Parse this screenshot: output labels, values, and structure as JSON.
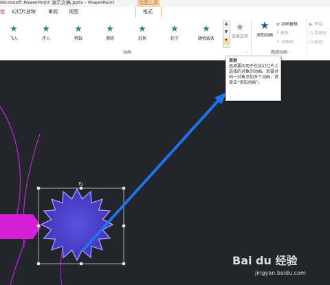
{
  "window": {
    "title": "演示文稿.pptx - PowerPoint",
    "title_prefix": "Microsoft PowerPoint"
  },
  "contextual_group": {
    "label": "绘图工具"
  },
  "tabs": [
    "幻灯片放映",
    "审阅",
    "视图",
    "格式"
  ],
  "tab_fragment": "始",
  "ribbon": {
    "animations": [
      "飞入",
      "浮入",
      "劈裂",
      "擦除",
      "形状",
      "轮子",
      "随机线条"
    ],
    "effect_options_label": "效果选项",
    "add_animation_label": "添加动画",
    "commands": {
      "animation_pane": "动画窗格",
      "trigger": "触发",
      "animation_painter": "动画刷",
      "start": "开始:",
      "duration": "持续时",
      "delay": "延迟:"
    },
    "group_labels": {
      "animation": "动画",
      "advanced": "高级动画"
    }
  },
  "tooltip": {
    "title": "其他",
    "body": "选择要应用于在此幻灯片上选择的对象的动画。若要对同一对象添加多个动画，请单击“添加动画”。"
  },
  "watermark": {
    "brand": "Bai du 经验",
    "url": "jingyan.baidu.com"
  },
  "colors": {
    "slide_bg": "#22252a",
    "accent_arrow": "#1e73f0",
    "shape_fill": "#4a3fc9",
    "banner_fill": "#d51fd6",
    "star_green": "#2a8a6e"
  },
  "icons": {
    "animation_preset": "green-star-icon",
    "effect_options": "grey-star-icon",
    "add_animation": "blue-star-icon"
  }
}
